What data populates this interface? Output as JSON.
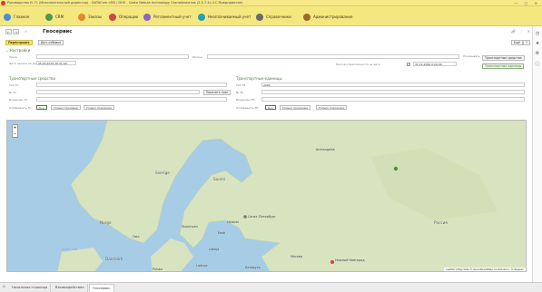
{
  "window": {
    "title": "Руководство И. П. (Исполнительный директор) - DATACom LMS / DHS - Costa Nebula technology Сертификатов (2.0.7.4) (1С:Предприятие)"
  },
  "sections": [
    {
      "label": "Главное",
      "color": "#4b8dd6"
    },
    {
      "label": "CRM",
      "color": "#4a9a4a"
    },
    {
      "label": "Заказы",
      "color": "#e08a2a"
    },
    {
      "label": "Операции",
      "color": "#c94a4a"
    },
    {
      "label": "Регламентный учет",
      "color": "#8a63c7"
    },
    {
      "label": "Неоплачиваемый учет",
      "color": "#2a9fae"
    },
    {
      "label": "Справочники",
      "color": "#6a6a6a"
    },
    {
      "label": "Администрирование",
      "color": "#a06a2a"
    }
  ],
  "form": {
    "title": "Геосервис",
    "more": "Ещё",
    "help": "?",
    "commands": {
      "refresh": "Перестроить",
      "add_notes": "Доп. отбивка"
    }
  },
  "settings": {
    "group": "Настройки",
    "order_label": "Заказ",
    "region_label": "Регион",
    "date_label": "Дата начала на дату",
    "date_value": "25.03.2019 16:31:00",
    "plan_label": "Прогноз безопасности на дату",
    "plan_value": "31.12.2099 0:00:00",
    "show_label": "Показывать",
    "btn_vehicles": "Транспортные средства",
    "btn_units": "Транспортные единицы"
  },
  "vehicles": {
    "group": "Транспортные средства",
    "type_label": "Тип ТС",
    "num_label": "№ ТС",
    "owner_label": "Владелец ТС",
    "show_label": "Отображать ТС",
    "find_btn": "Показать трек",
    "tabs": [
      "Все",
      "Только грузовые",
      "Только порожние"
    ]
  },
  "units": {
    "group": "Транспортные единицы",
    "type_label": "Тип ТЕ",
    "type_value": "20DC",
    "num_label": "№ ТЕ",
    "owner_label": "Владелец ТЕ",
    "show_label": "Отображать ТЕ",
    "tabs": [
      "Все",
      "Только груженые",
      "Только порожние"
    ]
  },
  "map": {
    "zoom_in": "+",
    "zoom_out": "−",
    "attribution": "Leaflet | Map data © OpenStreetMap contributors, © Яндекс",
    "places": [
      {
        "name": "Sverige",
        "cls": "big"
      },
      {
        "name": "Suomi",
        "cls": "big"
      },
      {
        "name": "Norge",
        "cls": "big"
      },
      {
        "name": "Eesti",
        "cls": ""
      },
      {
        "name": "Latvija",
        "cls": ""
      },
      {
        "name": "Lietuva",
        "cls": ""
      },
      {
        "name": "Danmark",
        "cls": "big"
      },
      {
        "name": "North Sea",
        "cls": "sea"
      },
      {
        "name": "Oslo",
        "cls": ""
      },
      {
        "name": "Stockholm",
        "cls": ""
      },
      {
        "name": "Helsinki",
        "cls": ""
      },
      {
        "name": "Санкт-Петербург",
        "cls": ""
      },
      {
        "name": "Москва",
        "cls": ""
      },
      {
        "name": "Нижний Новгород",
        "cls": ""
      },
      {
        "name": "Беларусь",
        "cls": ""
      },
      {
        "name": "Россия",
        "cls": "big"
      },
      {
        "name": "Polska",
        "cls": ""
      },
      {
        "name": "Archangelsk",
        "cls": ""
      }
    ]
  },
  "taskbar": [
    "Начальная страница",
    "Взаимодействия",
    "Геосервис"
  ],
  "accent": "#fbe56a",
  "group_color": "#4a7c3a"
}
